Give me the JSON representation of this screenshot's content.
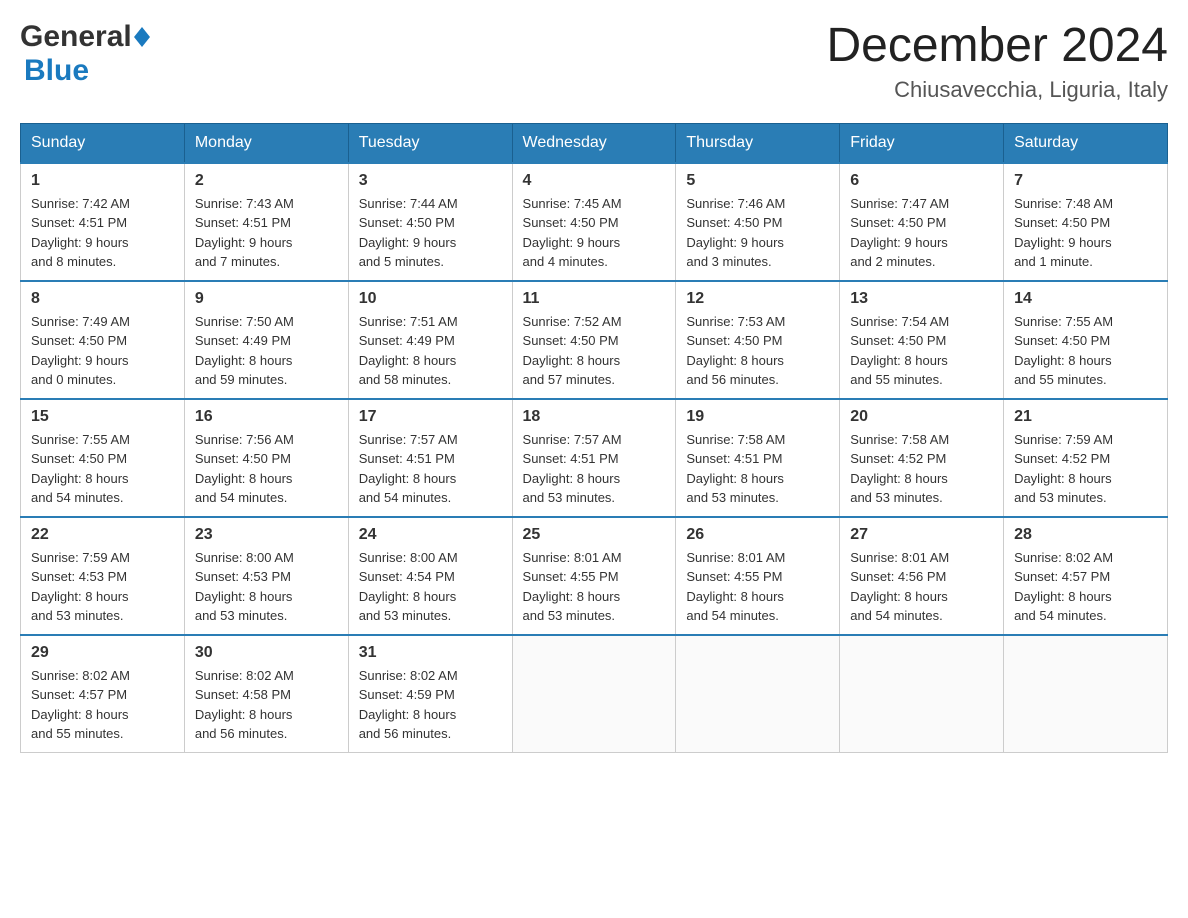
{
  "logo": {
    "general": "General",
    "blue": "Blue"
  },
  "title": "December 2024",
  "subtitle": "Chiusavecchia, Liguria, Italy",
  "headers": [
    "Sunday",
    "Monday",
    "Tuesday",
    "Wednesday",
    "Thursday",
    "Friday",
    "Saturday"
  ],
  "weeks": [
    [
      {
        "day": "1",
        "info": "Sunrise: 7:42 AM\nSunset: 4:51 PM\nDaylight: 9 hours\nand 8 minutes."
      },
      {
        "day": "2",
        "info": "Sunrise: 7:43 AM\nSunset: 4:51 PM\nDaylight: 9 hours\nand 7 minutes."
      },
      {
        "day": "3",
        "info": "Sunrise: 7:44 AM\nSunset: 4:50 PM\nDaylight: 9 hours\nand 5 minutes."
      },
      {
        "day": "4",
        "info": "Sunrise: 7:45 AM\nSunset: 4:50 PM\nDaylight: 9 hours\nand 4 minutes."
      },
      {
        "day": "5",
        "info": "Sunrise: 7:46 AM\nSunset: 4:50 PM\nDaylight: 9 hours\nand 3 minutes."
      },
      {
        "day": "6",
        "info": "Sunrise: 7:47 AM\nSunset: 4:50 PM\nDaylight: 9 hours\nand 2 minutes."
      },
      {
        "day": "7",
        "info": "Sunrise: 7:48 AM\nSunset: 4:50 PM\nDaylight: 9 hours\nand 1 minute."
      }
    ],
    [
      {
        "day": "8",
        "info": "Sunrise: 7:49 AM\nSunset: 4:50 PM\nDaylight: 9 hours\nand 0 minutes."
      },
      {
        "day": "9",
        "info": "Sunrise: 7:50 AM\nSunset: 4:49 PM\nDaylight: 8 hours\nand 59 minutes."
      },
      {
        "day": "10",
        "info": "Sunrise: 7:51 AM\nSunset: 4:49 PM\nDaylight: 8 hours\nand 58 minutes."
      },
      {
        "day": "11",
        "info": "Sunrise: 7:52 AM\nSunset: 4:50 PM\nDaylight: 8 hours\nand 57 minutes."
      },
      {
        "day": "12",
        "info": "Sunrise: 7:53 AM\nSunset: 4:50 PM\nDaylight: 8 hours\nand 56 minutes."
      },
      {
        "day": "13",
        "info": "Sunrise: 7:54 AM\nSunset: 4:50 PM\nDaylight: 8 hours\nand 55 minutes."
      },
      {
        "day": "14",
        "info": "Sunrise: 7:55 AM\nSunset: 4:50 PM\nDaylight: 8 hours\nand 55 minutes."
      }
    ],
    [
      {
        "day": "15",
        "info": "Sunrise: 7:55 AM\nSunset: 4:50 PM\nDaylight: 8 hours\nand 54 minutes."
      },
      {
        "day": "16",
        "info": "Sunrise: 7:56 AM\nSunset: 4:50 PM\nDaylight: 8 hours\nand 54 minutes."
      },
      {
        "day": "17",
        "info": "Sunrise: 7:57 AM\nSunset: 4:51 PM\nDaylight: 8 hours\nand 54 minutes."
      },
      {
        "day": "18",
        "info": "Sunrise: 7:57 AM\nSunset: 4:51 PM\nDaylight: 8 hours\nand 53 minutes."
      },
      {
        "day": "19",
        "info": "Sunrise: 7:58 AM\nSunset: 4:51 PM\nDaylight: 8 hours\nand 53 minutes."
      },
      {
        "day": "20",
        "info": "Sunrise: 7:58 AM\nSunset: 4:52 PM\nDaylight: 8 hours\nand 53 minutes."
      },
      {
        "day": "21",
        "info": "Sunrise: 7:59 AM\nSunset: 4:52 PM\nDaylight: 8 hours\nand 53 minutes."
      }
    ],
    [
      {
        "day": "22",
        "info": "Sunrise: 7:59 AM\nSunset: 4:53 PM\nDaylight: 8 hours\nand 53 minutes."
      },
      {
        "day": "23",
        "info": "Sunrise: 8:00 AM\nSunset: 4:53 PM\nDaylight: 8 hours\nand 53 minutes."
      },
      {
        "day": "24",
        "info": "Sunrise: 8:00 AM\nSunset: 4:54 PM\nDaylight: 8 hours\nand 53 minutes."
      },
      {
        "day": "25",
        "info": "Sunrise: 8:01 AM\nSunset: 4:55 PM\nDaylight: 8 hours\nand 53 minutes."
      },
      {
        "day": "26",
        "info": "Sunrise: 8:01 AM\nSunset: 4:55 PM\nDaylight: 8 hours\nand 54 minutes."
      },
      {
        "day": "27",
        "info": "Sunrise: 8:01 AM\nSunset: 4:56 PM\nDaylight: 8 hours\nand 54 minutes."
      },
      {
        "day": "28",
        "info": "Sunrise: 8:02 AM\nSunset: 4:57 PM\nDaylight: 8 hours\nand 54 minutes."
      }
    ],
    [
      {
        "day": "29",
        "info": "Sunrise: 8:02 AM\nSunset: 4:57 PM\nDaylight: 8 hours\nand 55 minutes."
      },
      {
        "day": "30",
        "info": "Sunrise: 8:02 AM\nSunset: 4:58 PM\nDaylight: 8 hours\nand 56 minutes."
      },
      {
        "day": "31",
        "info": "Sunrise: 8:02 AM\nSunset: 4:59 PM\nDaylight: 8 hours\nand 56 minutes."
      },
      null,
      null,
      null,
      null
    ]
  ]
}
